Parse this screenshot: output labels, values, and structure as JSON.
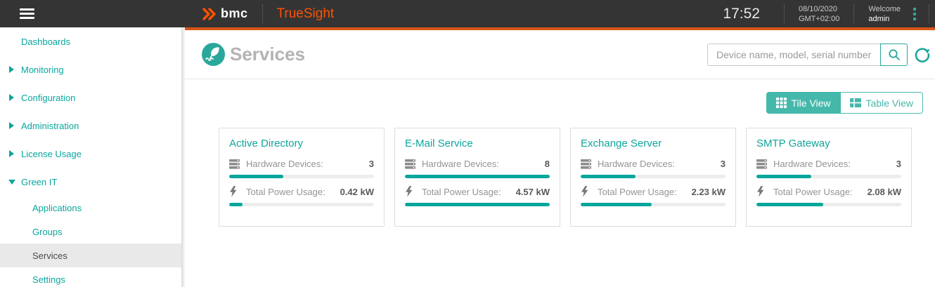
{
  "header": {
    "brand": "bmc",
    "product": "TrueSight",
    "time": "17:52",
    "date": "08/10/2020",
    "timezone": "GMT+02:00",
    "welcome_label": "Welcome",
    "username": "admin"
  },
  "sidebar": {
    "items": [
      {
        "label": "Dashboards",
        "state": "plain"
      },
      {
        "label": "Monitoring",
        "state": "collapsed"
      },
      {
        "label": "Configuration",
        "state": "collapsed"
      },
      {
        "label": "Administration",
        "state": "collapsed"
      },
      {
        "label": "License Usage",
        "state": "collapsed"
      },
      {
        "label": "Green IT",
        "state": "expanded"
      }
    ],
    "green_it_children": [
      {
        "label": "Applications",
        "selected": false
      },
      {
        "label": "Groups",
        "selected": false
      },
      {
        "label": "Services",
        "selected": true
      },
      {
        "label": "Settings",
        "selected": false
      }
    ]
  },
  "page": {
    "title": "Services",
    "search_placeholder": "Device name, model, serial number",
    "view_toggle": {
      "tile_label": "Tile View",
      "table_label": "Table View",
      "active": "Tile View"
    }
  },
  "labels": {
    "hardware": "Hardware Devices:",
    "power": "Total Power Usage:"
  },
  "services": [
    {
      "name": "Active Directory",
      "hardware_count": "3",
      "hardware_pct": 37.5,
      "power_value": "0.42 kW",
      "power_pct": 9
    },
    {
      "name": "E-Mail Service",
      "hardware_count": "8",
      "hardware_pct": 100,
      "power_value": "4.57 kW",
      "power_pct": 100
    },
    {
      "name": "Exchange Server",
      "hardware_count": "3",
      "hardware_pct": 38,
      "power_value": "2.23 kW",
      "power_pct": 49
    },
    {
      "name": "SMTP Gateway",
      "hardware_count": "3",
      "hardware_pct": 38,
      "power_value": "2.08 kW",
      "power_pct": 46
    }
  ],
  "colors": {
    "accent_teal": "#09a69e",
    "progress_teal": "#00a79a",
    "brand_orange": "#fe5000",
    "topbar_dark": "#343434"
  }
}
